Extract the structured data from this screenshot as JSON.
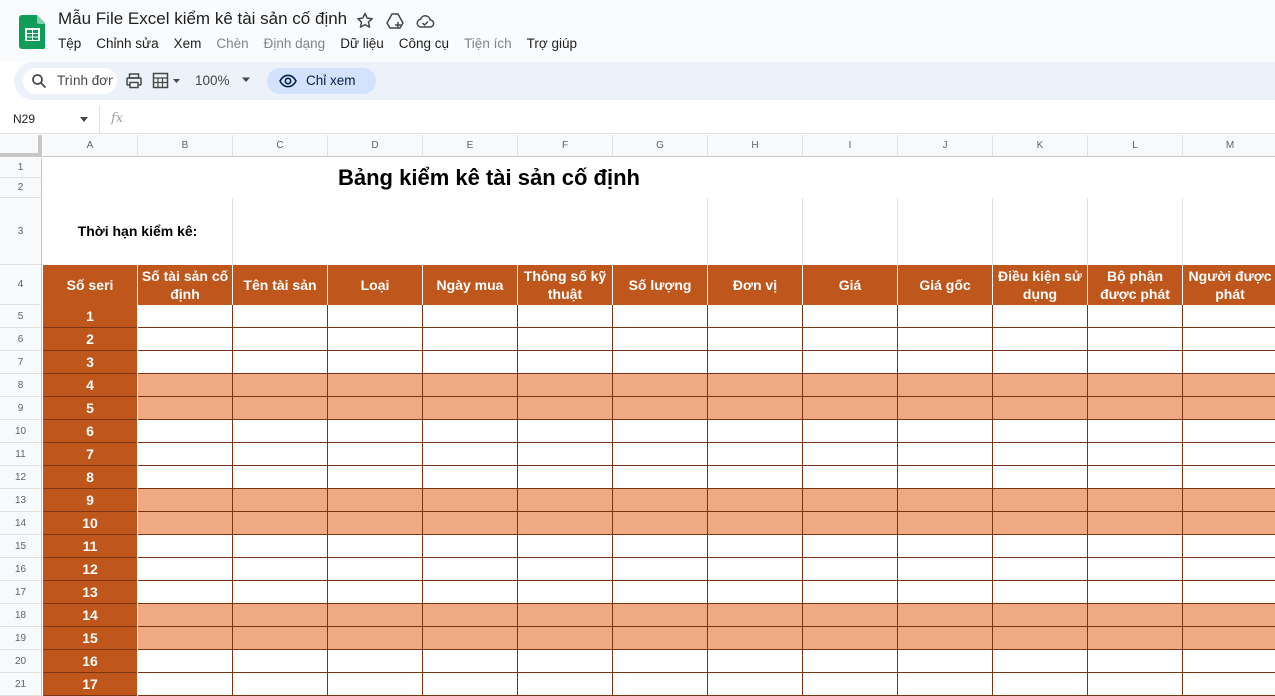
{
  "app": {
    "doc_title": "Mẫu File Excel kiểm kê tài sản cố định",
    "brand_color": "#0f9d58"
  },
  "menu": [
    {
      "label": "Tệp",
      "enabled": true
    },
    {
      "label": "Chỉnh sửa",
      "enabled": true
    },
    {
      "label": "Xem",
      "enabled": true
    },
    {
      "label": "Chèn",
      "enabled": false
    },
    {
      "label": "Định dạng",
      "enabled": false
    },
    {
      "label": "Dữ liệu",
      "enabled": true
    },
    {
      "label": "Công cụ",
      "enabled": true
    },
    {
      "label": "Tiện ích",
      "enabled": false
    },
    {
      "label": "Trợ giúp",
      "enabled": true
    }
  ],
  "toolbar": {
    "search_placeholder": "Trình đơn",
    "zoom": "100%",
    "view_only_label": "Chỉ xem"
  },
  "formula_bar": {
    "cell_ref": "N29",
    "fx": "fx"
  },
  "sheet": {
    "columns": [
      "A",
      "B",
      "C",
      "D",
      "E",
      "F",
      "G",
      "H",
      "I",
      "J",
      "K",
      "L",
      "M"
    ],
    "rows": [
      "1",
      "2",
      "3",
      "4",
      "5",
      "6",
      "7",
      "8",
      "9",
      "10",
      "11",
      "12",
      "13",
      "14",
      "15",
      "16",
      "17",
      "18",
      "19",
      "20",
      "21"
    ],
    "title": "Bảng kiểm kê tài sản cố định",
    "period_label": "Thời hạn kiểm kê:",
    "headers": [
      "Số seri",
      "Số tài sản cố định",
      "Tên tài sản",
      "Loại",
      "Ngày mua",
      "Thông số kỹ thuật",
      "Số lượng",
      "Đơn vị",
      "Giá",
      "Giá gốc",
      "Điều kiện sử dụng",
      "Bộ phận được phát",
      "Người được phát"
    ],
    "serials": [
      "1",
      "2",
      "3",
      "4",
      "5",
      "6",
      "7",
      "8",
      "9",
      "10",
      "11",
      "12",
      "13",
      "14",
      "15",
      "16",
      "17"
    ],
    "row_band": [
      "white",
      "white",
      "white",
      "peach",
      "peach",
      "white",
      "white",
      "white",
      "peach",
      "peach",
      "white",
      "white",
      "white",
      "peach",
      "peach",
      "white",
      "white"
    ],
    "colors": {
      "header_bg": "#bf561b",
      "band_peach": "#efaa84",
      "border": "#7a3411"
    }
  }
}
